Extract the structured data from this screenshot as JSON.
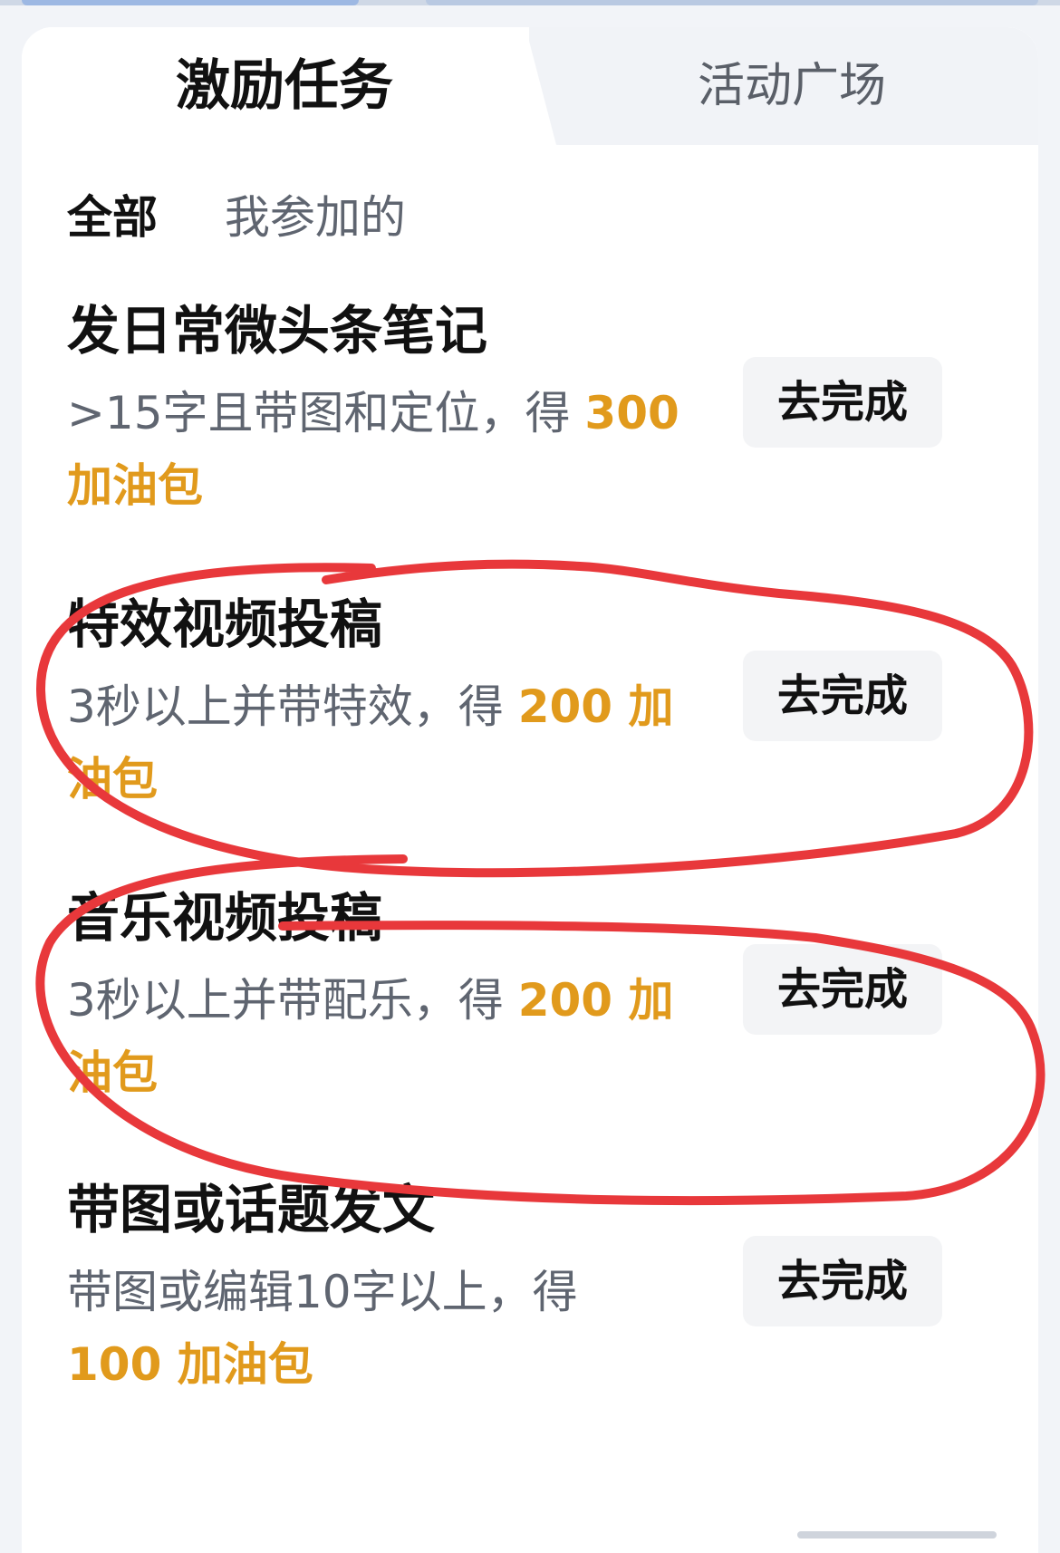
{
  "tabs": {
    "active_label": "激励任务",
    "inactive_label": "活动广场"
  },
  "filters": {
    "all": "全部",
    "mine": "我参加的"
  },
  "tasks": [
    {
      "title": "发日常微头条笔记",
      "desc_prefix": ">15字且带图和定位，得 ",
      "reward": "300",
      "reward_suffix": " 加油包",
      "button": "去完成"
    },
    {
      "title": "特效视频投稿",
      "desc_prefix": "3秒以上并带特效，得 ",
      "reward": "200",
      "reward_suffix": " 加油包",
      "button": "去完成"
    },
    {
      "title": "音乐视频投稿",
      "desc_prefix": "3秒以上并带配乐，得 ",
      "reward": "200",
      "reward_suffix": " 加油包",
      "button": "去完成"
    },
    {
      "title": "带图或话题发文",
      "desc_prefix": "带图或编辑10字以上，得 ",
      "reward": "100",
      "reward_suffix": " 加油包",
      "button": "去完成"
    }
  ],
  "colors": {
    "reward": "#e19a1c",
    "annotation": "#e8383b",
    "title": "#111111",
    "secondary_text": "#5f6570"
  }
}
